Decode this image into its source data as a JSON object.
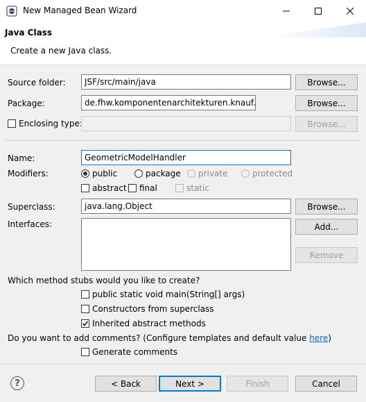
{
  "window": {
    "title": "New Managed Bean Wizard"
  },
  "header": {
    "title": "Java Class",
    "subtitle": "Create a new Java class."
  },
  "form": {
    "source_folder": {
      "label": "Source folder:",
      "value": "JSF/src/main/java",
      "browse": "Browse..."
    },
    "package": {
      "label": "Package:",
      "value": "de.fhw.komponentenarchitekturen.knauf.jsf",
      "browse": "Browse..."
    },
    "enclosing_type": {
      "label": "Enclosing type:",
      "value": "",
      "browse": "Browse...",
      "checked": false
    },
    "name": {
      "label": "Name:",
      "value": "GeometricModelHandler"
    },
    "modifiers": {
      "label": "Modifiers:",
      "options": [
        "public",
        "package",
        "private",
        "protected"
      ],
      "selected": "public",
      "abstract": "abstract",
      "final": "final",
      "static": "static"
    },
    "superclass": {
      "label": "Superclass:",
      "value": "java.lang.Object",
      "browse": "Browse..."
    },
    "interfaces": {
      "label": "Interfaces:",
      "add": "Add...",
      "remove": "Remove"
    },
    "stubs": {
      "question": "Which method stubs would you like to create?",
      "main": "public static void main(String[] args)",
      "constructors": "Constructors from superclass",
      "inherited": "Inherited abstract methods",
      "main_checked": false,
      "constructors_checked": false,
      "inherited_checked": true
    },
    "comments": {
      "question": "Do you want to add comments? (Configure templates and default value ",
      "link": "here",
      "close": ")",
      "generate": "Generate comments",
      "checked": false
    }
  },
  "footer": {
    "help": "?",
    "back": "< Back",
    "next": "Next >",
    "finish": "Finish",
    "cancel": "Cancel"
  },
  "colors": {
    "accent": "#0078d7",
    "link": "#0066cc"
  }
}
